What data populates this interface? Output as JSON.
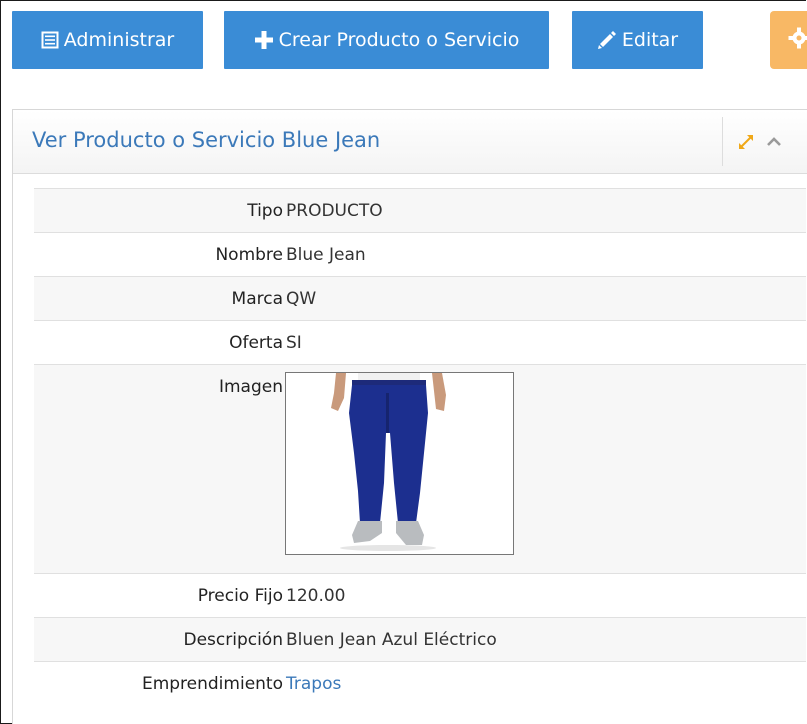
{
  "toolbar": {
    "admin_label": "Administrar",
    "create_label": "Crear Producto o Servicio",
    "edit_label": "Editar"
  },
  "panel": {
    "title": "Ver Producto o Servicio Blue Jean"
  },
  "details": {
    "tipo": {
      "label": "Tipo",
      "value": "PRODUCTO"
    },
    "nombre": {
      "label": "Nombre",
      "value": "Blue Jean"
    },
    "marca": {
      "label": "Marca",
      "value": "QW"
    },
    "oferta": {
      "label": "Oferta",
      "value": "SI"
    },
    "imagen": {
      "label": "Imagen"
    },
    "precio": {
      "label": "Precio Fijo",
      "value": "120.00"
    },
    "descripcion": {
      "label": "Descripción",
      "value": "Bluen Jean Azul Eléctrico"
    },
    "emprendimiento": {
      "label": "Emprendimiento",
      "value": "Trapos"
    }
  },
  "colors": {
    "primary_button": "#3a8cd6",
    "settings_button": "#f8b865",
    "title_link": "#3b79b9",
    "expand_icon": "#f0a818"
  },
  "icons": [
    "list-icon",
    "plus-icon",
    "pencil-icon",
    "gear-icon",
    "expand-icon",
    "chevron-up-icon"
  ]
}
